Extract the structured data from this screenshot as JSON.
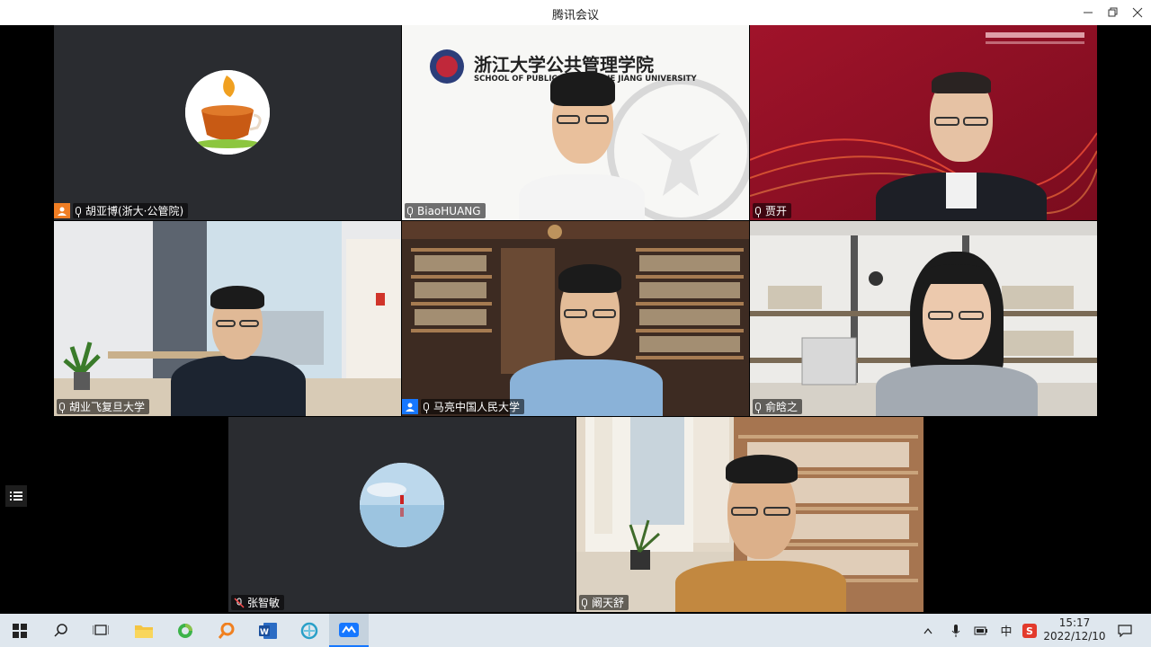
{
  "window": {
    "title": "腾讯会议"
  },
  "participants": [
    {
      "name": "胡亚博(浙大·公管院)",
      "video": false
    },
    {
      "name": "BiaoHUANG",
      "video": true
    },
    {
      "name": "贾开",
      "video": true
    },
    {
      "name": "胡业飞复旦大学",
      "video": true
    },
    {
      "name": "马亮中国人民大学",
      "video": true
    },
    {
      "name": "俞晗之",
      "video": true
    },
    {
      "name": "张智敏",
      "video": false
    },
    {
      "name": "阚天舒",
      "video": true
    }
  ],
  "banner": {
    "cn": "浙江大学公共管理学院",
    "en": "SCHOOL OF PUBLIC AFFAIRS ZHE JIANG UNIVERSITY"
  },
  "taskbar": {
    "time": "15:17",
    "date": "2022/12/10",
    "ime": "中"
  },
  "colors": {
    "titlebar": "#ffffff",
    "tile_bg": "#2a2c30",
    "taskbar": "#dfe7ee",
    "accent": "#1677ff",
    "host_badge": "#f07e24",
    "banner_red": "#b2172a"
  }
}
